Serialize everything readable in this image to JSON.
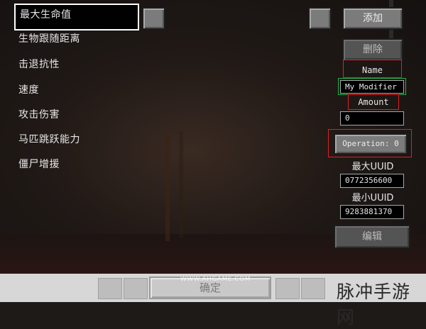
{
  "attributes": {
    "items": [
      {
        "label": "最大生命值"
      },
      {
        "label": "生物跟随距离"
      },
      {
        "label": "击退抗性"
      },
      {
        "label": "速度"
      },
      {
        "label": "攻击伤害"
      },
      {
        "label": "马匹跳跃能力"
      },
      {
        "label": "僵尸增援"
      }
    ]
  },
  "buttons": {
    "add": "添加",
    "delete": "删除",
    "edit": "编辑",
    "confirm": "确定"
  },
  "modifier": {
    "name_label": "Name",
    "name_value": "My Modifier",
    "amount_label": "Amount",
    "amount_value": "0",
    "operation_button": "Operation: 0",
    "max_uuid_label": "最大UUID",
    "max_uuid_value": "0772356600",
    "min_uuid_label": "最小UUID",
    "min_uuid_value": "9283881370"
  },
  "watermark": {
    "small": "WWW.AHGAME.COM",
    "big": "脉冲手游网"
  },
  "colors": {
    "highlight_red": "#e02020",
    "highlight_green": "#1db24a"
  }
}
